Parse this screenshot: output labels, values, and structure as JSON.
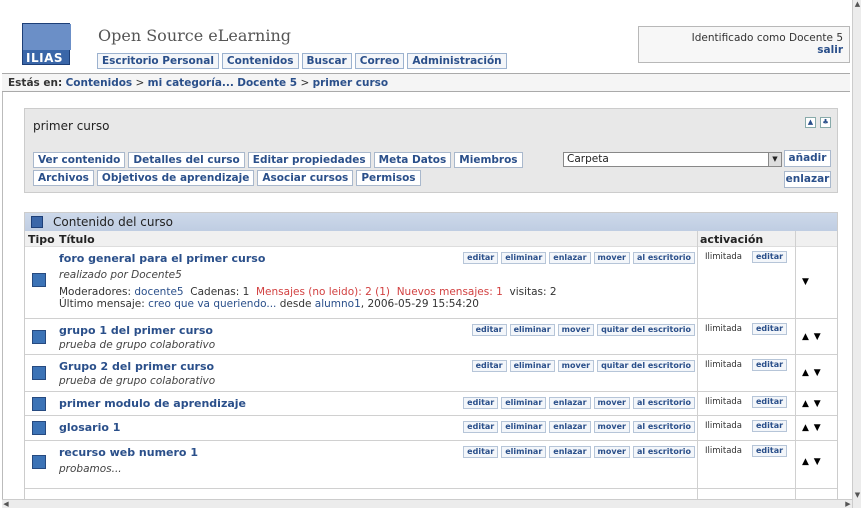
{
  "app": {
    "logo_text": "ILIAS",
    "site_title": "Open Source eLearning"
  },
  "mainnav": [
    "Escritorio Personal",
    "Contenidos",
    "Buscar",
    "Correo",
    "Administración"
  ],
  "user": {
    "identified_text": "Identificado como Docente 5",
    "logout": "salir"
  },
  "breadcrumb": {
    "label": "Estás en:",
    "items": [
      "Contenidos",
      "mi categoría...",
      "Docente 5",
      "primer curso"
    ],
    "separator": ">"
  },
  "course": {
    "title": "primer curso"
  },
  "tabs": {
    "row1": [
      "Ver contenido",
      "Detalles del curso",
      "Editar propiedades",
      "Meta Datos",
      "Miembros"
    ],
    "row2": [
      "Archivos",
      "Objetivos de aprendizaje",
      "Asociar cursos",
      "Permisos"
    ]
  },
  "add": {
    "select_value": "Carpeta",
    "add_label": "añadir",
    "link_label": "enlazar"
  },
  "content": {
    "title": "Contenido del curso",
    "columns": {
      "tipo": "Tipo",
      "titulo": "Título",
      "activacion": "activación"
    },
    "rows": [
      {
        "title": "foro general para el primer curso",
        "actions": [
          "editar",
          "eliminar",
          "enlazar",
          "mover",
          "al escritorio"
        ],
        "activation": "Ilimitada",
        "edit": "editar",
        "desc": "realizado por Docente5",
        "meta1": {
          "mod_label": "Moderadores:",
          "mod_value": "docente5",
          "threads": "Cadenas: 1",
          "unread": "Mensajes (no leido): 2 (1)",
          "new_label": "Nuevos mensajes:",
          "new_value": "1",
          "visits": "visitas: 2"
        },
        "meta2": {
          "last_label": "Último mensaje:",
          "last_value": "creo que va queriendo...",
          "from_label": "desde",
          "from_value": "alumno1",
          "date": ", 2006-05-29 15:54:20"
        },
        "arrows": "▼"
      },
      {
        "title": "grupo 1 del primer curso",
        "actions": [
          "editar",
          "eliminar",
          "mover",
          "quitar del escritorio"
        ],
        "activation": "Ilimitada",
        "edit": "editar",
        "desc": "prueba de grupo colaborativo",
        "arrows": "▲ ▼"
      },
      {
        "title": "Grupo 2 del primer curso",
        "actions": [
          "editar",
          "eliminar",
          "mover",
          "quitar del escritorio"
        ],
        "activation": "Ilimitada",
        "edit": "editar",
        "desc": "prueba de grupo colaborativo",
        "arrows": "▲ ▼"
      },
      {
        "title": "primer modulo de aprendizaje",
        "actions": [
          "editar",
          "eliminar",
          "enlazar",
          "mover",
          "al escritorio"
        ],
        "activation": "Ilimitada",
        "edit": "editar",
        "arrows": "▲ ▼"
      },
      {
        "title": "glosario 1",
        "actions": [
          "editar",
          "eliminar",
          "enlazar",
          "mover",
          "al escritorio"
        ],
        "activation": "Ilimitada",
        "edit": "editar",
        "arrows": "▲ ▼"
      },
      {
        "title": "recurso web numero 1",
        "actions": [
          "editar",
          "eliminar",
          "enlazar",
          "mover",
          "al escritorio"
        ],
        "activation": "Ilimitada",
        "edit": "editar",
        "desc": "probamos...",
        "arrows": "▲ ▼"
      }
    ]
  },
  "colors": {
    "link": "#2a4f8a",
    "accent": "#3a66a8",
    "alert": "#d24040"
  }
}
